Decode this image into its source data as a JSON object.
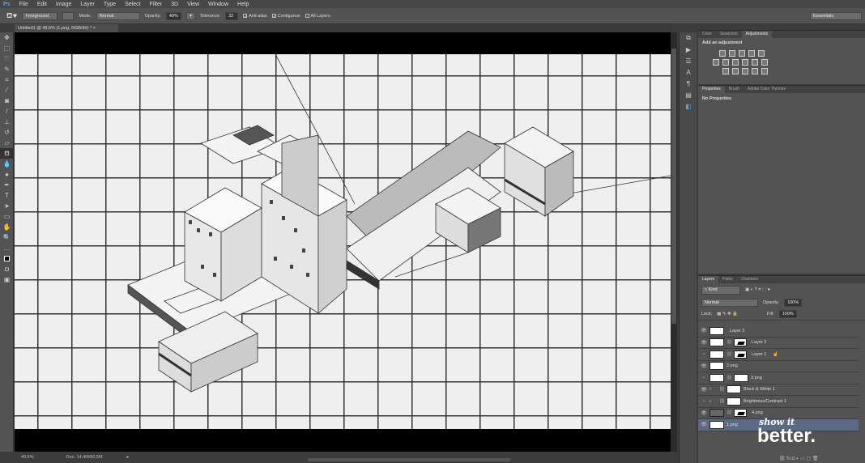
{
  "app": {
    "logo": "Ps",
    "menu": [
      "File",
      "Edit",
      "Image",
      "Layer",
      "Type",
      "Select",
      "Filter",
      "3D",
      "View",
      "Window",
      "Help"
    ],
    "workspace": "Essentials"
  },
  "options": {
    "tool_icon": "paint-bucket-icon",
    "fill_source": "Foreground",
    "mode_label": "Mode:",
    "mode": "Normal",
    "opacity_label": "Opacity:",
    "opacity": "40%",
    "tolerance_label": "Tolerance:",
    "tolerance": "32",
    "anti_alias": "Anti-alias",
    "anti_alias_checked": true,
    "contiguous": "Contiguous",
    "contiguous_checked": true,
    "all_layers": "All Layers",
    "all_layers_checked": false
  },
  "document": {
    "tab": "Untitled1 @ 49,6% (1.png, RGB/8#) *",
    "close": "×"
  },
  "status": {
    "zoom": "49,6%",
    "doc": "Doc: 14,4M/80,5M"
  },
  "adjustments_panel": {
    "tabs": [
      "Color",
      "Swatches",
      "Adjustments"
    ],
    "active": "Adjustments",
    "heading": "Add an adjustment"
  },
  "properties_panel": {
    "tabs": [
      "Properties",
      "Brush",
      "Adobe Color Themes"
    ],
    "active": "Properties",
    "message": "No Properties"
  },
  "layers_panel": {
    "tabs": [
      "Layers",
      "Paths",
      "Channels"
    ],
    "active": "Layers",
    "filter": "Kind",
    "blend_mode": "Normal",
    "opacity_label": "Opacity:",
    "opacity": "100%",
    "lock_label": "Lock:",
    "fill_label": "Fill:",
    "fill": "100%",
    "layers": [
      {
        "name": "Layer 3",
        "visible": true,
        "mask": false
      },
      {
        "name": "Layer 2",
        "visible": true,
        "mask": true
      },
      {
        "name": "Layer 1",
        "visible": false,
        "mask": true
      },
      {
        "name": "2.png",
        "visible": true,
        "mask": false
      },
      {
        "name": "3.png",
        "visible": false,
        "mask": true
      },
      {
        "name": "Black & White 1",
        "visible": true,
        "mask": true,
        "adjustment": true
      },
      {
        "name": "Brightness/Contrast 1",
        "visible": false,
        "mask": true,
        "adjustment": true
      },
      {
        "name": "4.png",
        "visible": true,
        "mask": true
      },
      {
        "name": "1.png",
        "visible": true,
        "mask": false,
        "selected": true
      }
    ]
  },
  "watermark": {
    "line1": "show it",
    "line2": "better."
  },
  "colors": {
    "selected_layer": "#5b6b85",
    "panel": "#535353"
  }
}
